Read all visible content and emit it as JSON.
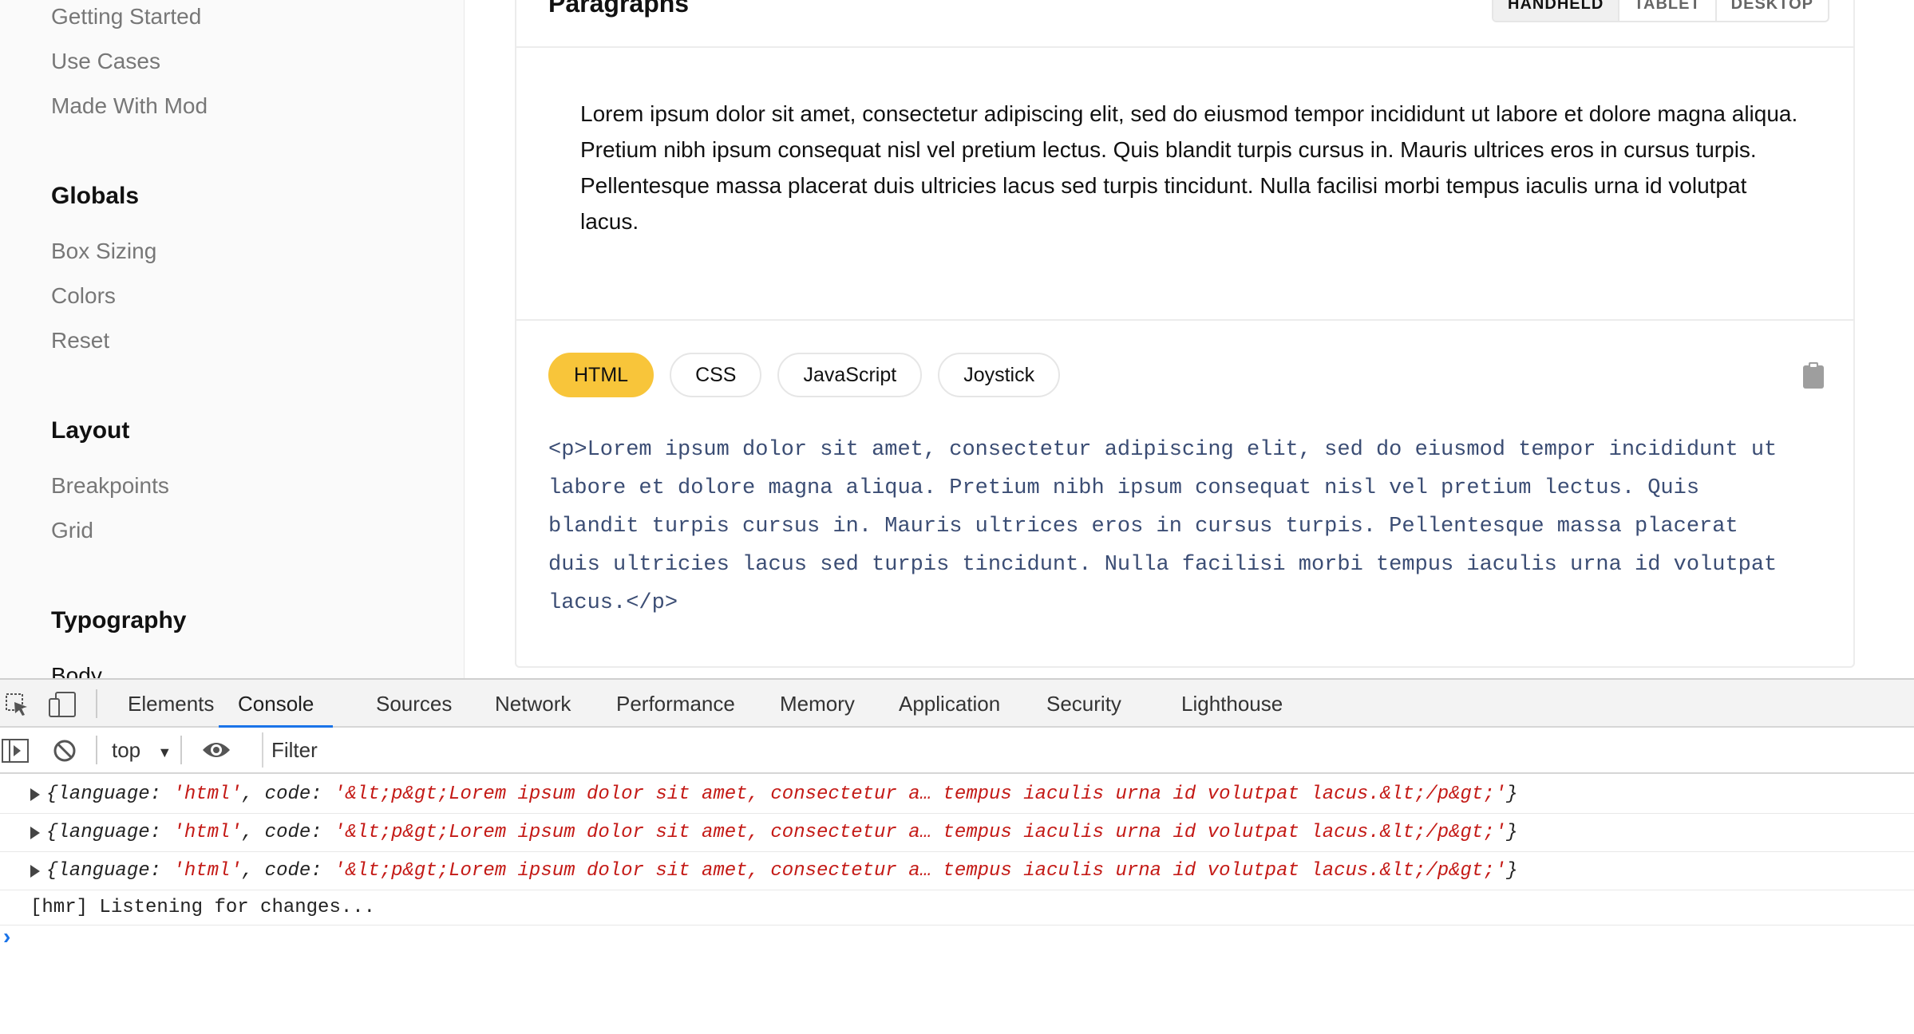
{
  "sidebar": {
    "links_top": [
      "Getting Started",
      "Use Cases",
      "Made With Mod"
    ],
    "sections": [
      {
        "heading": "Globals",
        "items": [
          "Box Sizing",
          "Colors",
          "Reset"
        ]
      },
      {
        "heading": "Layout",
        "items": [
          "Breakpoints",
          "Grid"
        ]
      },
      {
        "heading": "Typography",
        "items": [
          "Body"
        ]
      }
    ]
  },
  "panel": {
    "title": "Paragraphs",
    "viewport_buttons": [
      "HANDHELD",
      "TABLET",
      "DESKTOP"
    ],
    "preview_text": "Lorem ipsum dolor sit amet, consectetur adipiscing elit, sed do eiusmod tempor incididunt ut labore et dolore magna aliqua. Pretium nibh ipsum consequat nisl vel pretium lectus. Quis blandit turpis cursus in. Mauris ultrices eros in cursus turpis. Pellentesque massa placerat duis ultricies lacus sed turpis tincidunt. Nulla facilisi morbi tempus iaculis urna id volutpat lacus.",
    "language_tabs": [
      "HTML",
      "CSS",
      "JavaScript",
      "Joystick"
    ],
    "active_tab": "HTML",
    "code": "<p>Lorem ipsum dolor sit amet, consectetur adipiscing elit, sed do eiusmod tempor incididunt ut labore et dolore magna aliqua. Pretium nibh ipsum consequat nisl vel pretium lectus. Quis blandit turpis cursus in. Mauris ultrices eros in cursus turpis. Pellentesque massa placerat duis ultricies lacus sed turpis tincidunt. Nulla facilisi morbi tempus iaculis urna id volutpat lacus.</p>",
    "accent_color": "#f8c53a"
  },
  "devtools": {
    "tabs": [
      "Elements",
      "Console",
      "Sources",
      "Network",
      "Performance",
      "Memory",
      "Application",
      "Security",
      "Lighthouse"
    ],
    "active_tab": "Console",
    "context": "top",
    "filter_placeholder": "Filter",
    "logs": [
      {
        "lang_key": "language",
        "lang_val": "'html'",
        "code_key": "code",
        "code_val": "'&lt;p&gt;Lorem ipsum dolor sit amet, consectetur a… tempus iaculis urna id volutpat lacus.&lt;/p&gt;'"
      },
      {
        "lang_key": "language",
        "lang_val": "'html'",
        "code_key": "code",
        "code_val": "'&lt;p&gt;Lorem ipsum dolor sit amet, consectetur a… tempus iaculis urna id volutpat lacus.&lt;/p&gt;'"
      },
      {
        "lang_key": "language",
        "lang_val": "'html'",
        "code_key": "code",
        "code_val": "'&lt;p&gt;Lorem ipsum dolor sit amet, consectetur a… tempus iaculis urna id volutpat lacus.&lt;/p&gt;'"
      }
    ],
    "plain_log": "[hmr] Listening for changes...",
    "prompt": "›",
    "link_color": "#1a73e8"
  }
}
